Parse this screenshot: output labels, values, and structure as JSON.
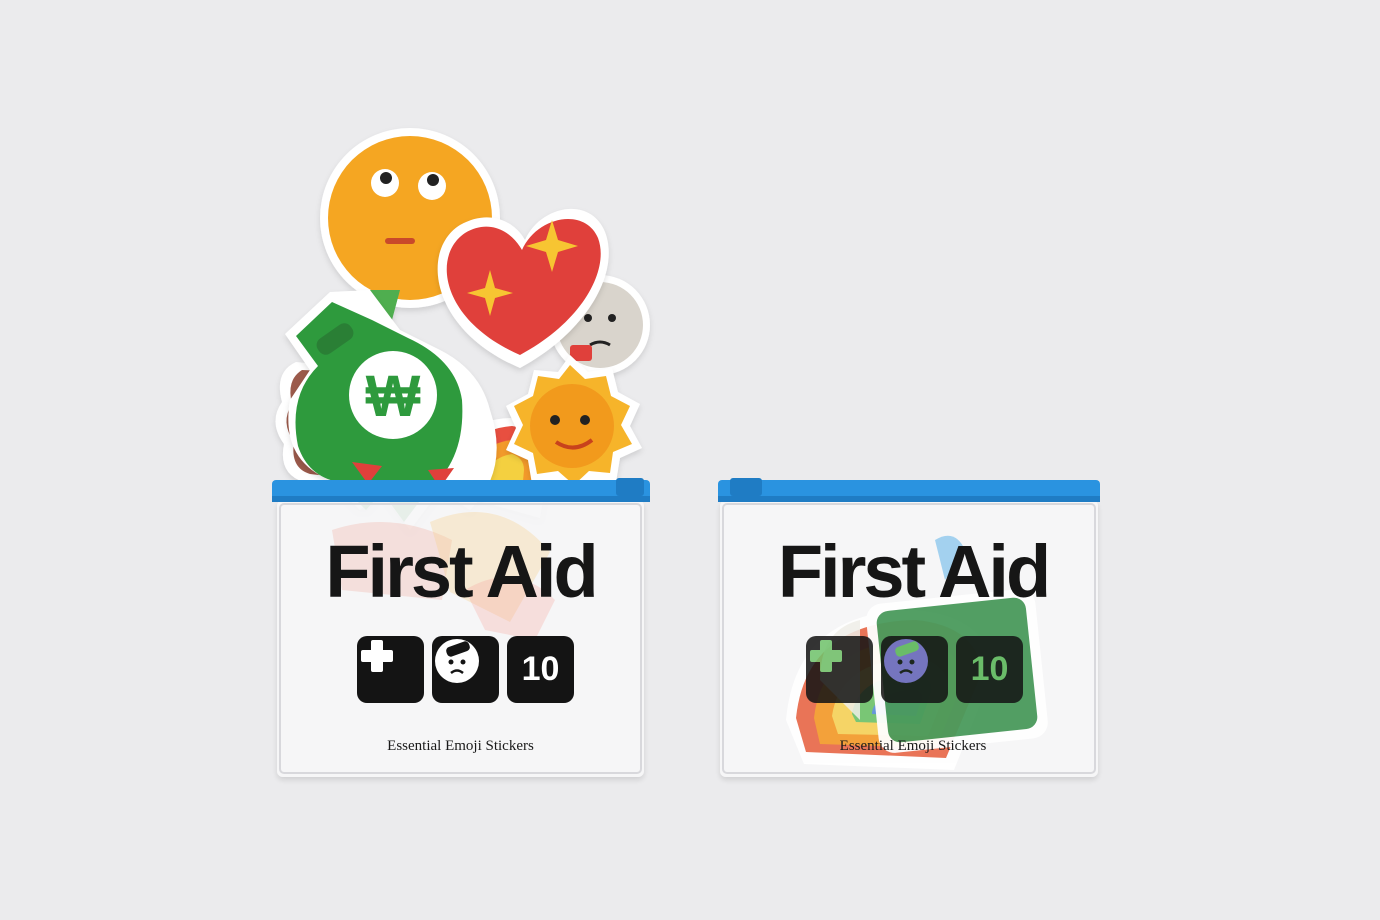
{
  "scene": {
    "background_color": "#ebebed",
    "zipper_color": "#2a93e0"
  },
  "packs": [
    {
      "id": "open",
      "title": "First Aid",
      "tagline": "Essential Emoji Stickers",
      "icons": [
        {
          "name": "plus-icon",
          "label": ""
        },
        {
          "name": "bandaged-face-icon",
          "label": ""
        },
        {
          "name": "count-icon",
          "label": "10"
        }
      ]
    },
    {
      "id": "closed",
      "title": "First Aid",
      "tagline": "Essential Emoji Stickers",
      "icons": [
        {
          "name": "plus-icon",
          "label": ""
        },
        {
          "name": "bandaged-face-icon",
          "label": ""
        },
        {
          "name": "count-icon",
          "label": "10"
        }
      ]
    }
  ],
  "stickers": [
    {
      "name": "rolling-eyes-face-sticker",
      "color": "#f5a623"
    },
    {
      "name": "sparkling-heart-sticker",
      "color": "#e0413a"
    },
    {
      "name": "money-bag-won-sticker",
      "color": "#2e9a3e"
    },
    {
      "name": "smiling-sun-sticker",
      "color": "#f29a1f"
    },
    {
      "name": "ghost-face-sticker",
      "color": "#d9d4cc"
    },
    {
      "name": "rainbow-sticker",
      "color": "#e86a4a"
    },
    {
      "name": "brown-blob-sticker",
      "color": "#9b5a4c"
    },
    {
      "name": "cash-stack-sticker",
      "color": "#4a9a5c"
    }
  ]
}
